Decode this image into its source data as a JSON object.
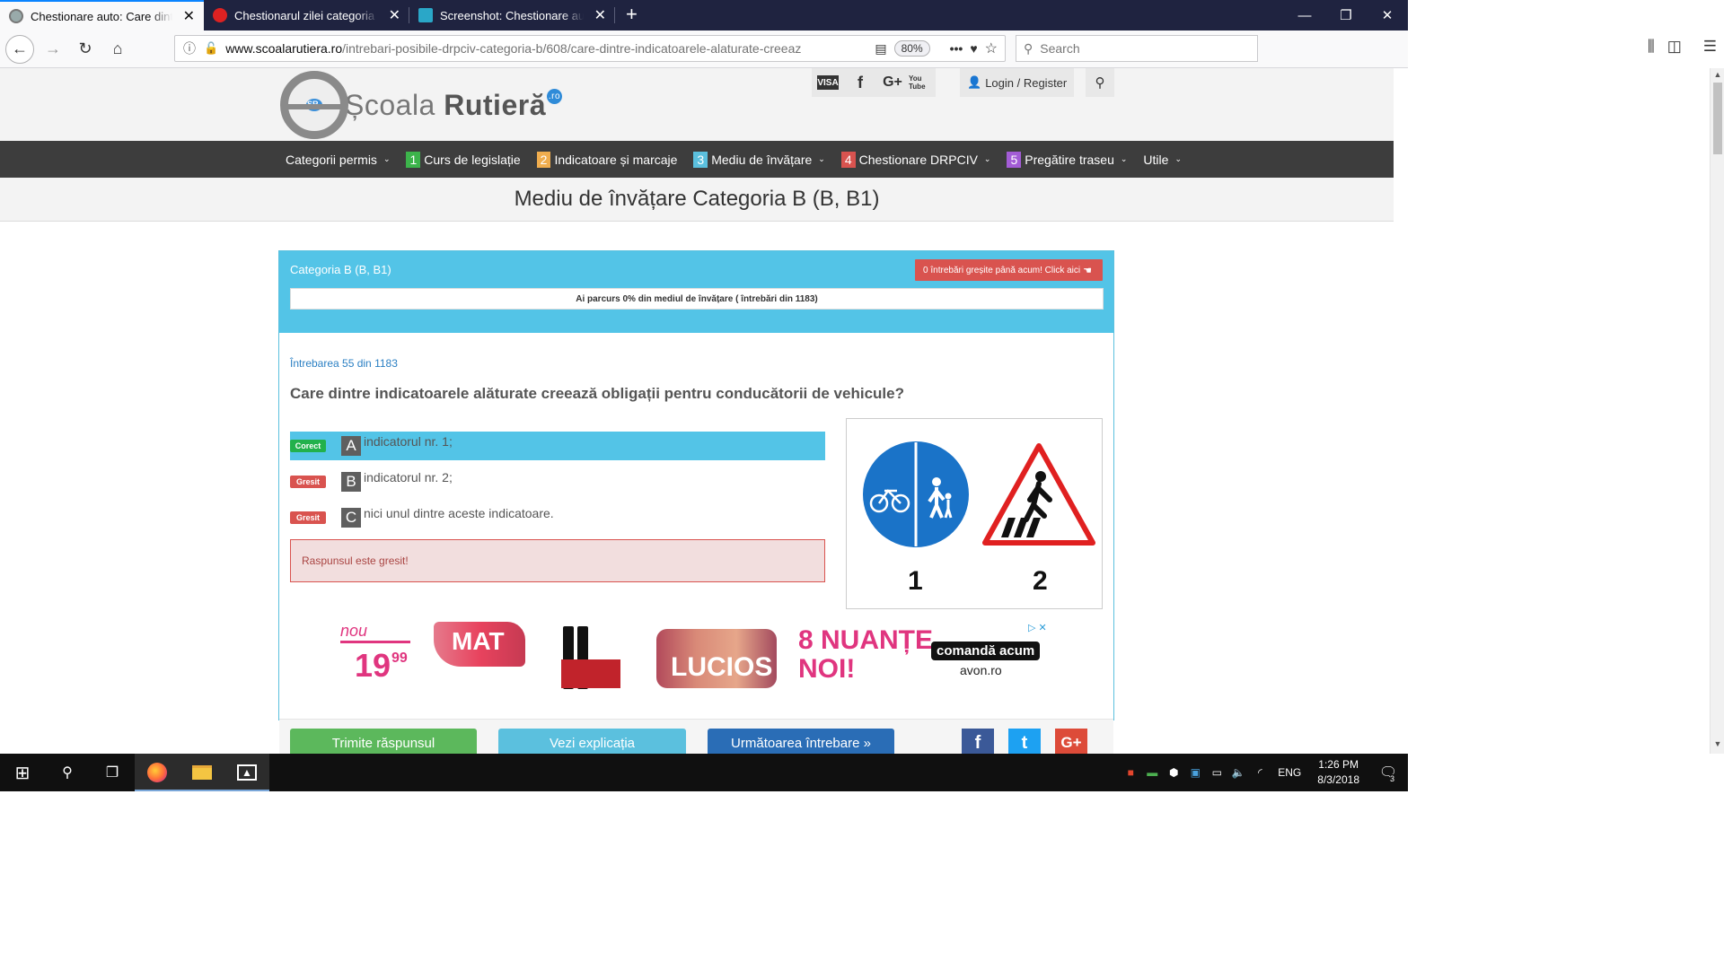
{
  "browser": {
    "tabs": [
      {
        "title": "Chestionare auto: Care dintre in",
        "active": true
      },
      {
        "title": "Chestionarul zilei categoria B -",
        "active": false
      },
      {
        "title": "Screenshot: Chestionare auto: C",
        "active": false
      }
    ],
    "url_domain": "www.scoalarutiera.ro",
    "url_path": "/intrebari-posibile-drpciv-categoria-b/608/care-dintre-indicatoarele-alaturate-creeaz",
    "zoom": "80%",
    "search_placeholder": "Search"
  },
  "site": {
    "logo_text": "Școala",
    "logo_text_bold": "Rutieră",
    "logo_ro": ".ro",
    "logo_sr": "SR",
    "social": [
      "VISA",
      "f",
      "G+",
      "You Tube"
    ],
    "login": "Login / Register",
    "nav": [
      {
        "num": "",
        "label": "Categorii permis",
        "dropdown": true,
        "color": ""
      },
      {
        "num": "1",
        "label": "Curs de legislație",
        "dropdown": false,
        "color": "#3cb44b"
      },
      {
        "num": "2",
        "label": "Indicatoare și marcaje",
        "dropdown": false,
        "color": "#f0ad4e"
      },
      {
        "num": "3",
        "label": "Mediu de învățare",
        "dropdown": true,
        "color": "#5bc0de"
      },
      {
        "num": "4",
        "label": "Chestionare DRPCIV",
        "dropdown": true,
        "color": "#d9534f"
      },
      {
        "num": "5",
        "label": "Pregătire traseu",
        "dropdown": true,
        "color": "#a35cd6"
      },
      {
        "num": "",
        "label": "Utile",
        "dropdown": true,
        "color": ""
      }
    ],
    "page_title": "Mediu de învățare Categoria B (B, B1)"
  },
  "quiz": {
    "category": "Categoria B (B, B1)",
    "wrong_button": "0 întrebări greșite până acum! Click aici",
    "progress_text": "Ai parcurs 0% din mediul de învățare ( întrebări din 1183)",
    "question_number": "Întrebarea 55 din 1183",
    "question": "Care dintre indicatoarele alăturate creează obligații pentru conducătorii de vehicule?",
    "answers": [
      {
        "status": "Corect",
        "letter": "A",
        "text": "indicatorul nr. 1;",
        "highlight": true
      },
      {
        "status": "Gresit",
        "letter": "B",
        "text": "indicatorul nr. 2;",
        "highlight": false
      },
      {
        "status": "Gresit",
        "letter": "C",
        "text": "nici unul dintre aceste indicatoare.",
        "highlight": false
      }
    ],
    "result": "Raspunsul este gresit!",
    "sign_labels": [
      "1",
      "2"
    ],
    "buttons": {
      "submit": "Trimite răspunsul",
      "explanation": "Vezi explicația",
      "next": "Următoarea întrebare »"
    },
    "share": [
      "f",
      "t",
      "G+"
    ]
  },
  "ad": {
    "nou": "nou",
    "price": "19",
    "price_cents": "99",
    "mat": "MAT",
    "lucios": "LUCIOS",
    "nuante": "8 NUANȚE",
    "noi": "NOI!",
    "cta": "comandă acum",
    "domain": "avon.ro"
  },
  "taskbar": {
    "lang": "ENG",
    "time": "1:26 PM",
    "date": "8/3/2018",
    "notifications": "3"
  }
}
